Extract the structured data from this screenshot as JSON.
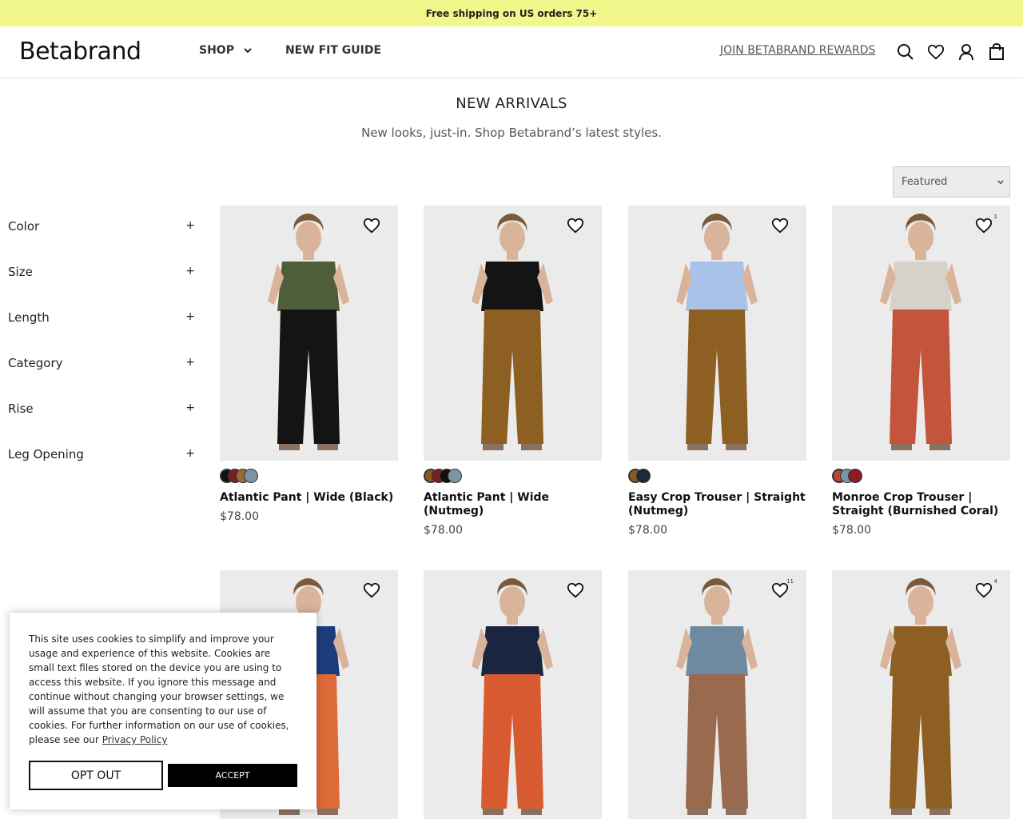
{
  "promo": {
    "text": "Free shipping on US orders 75+"
  },
  "header": {
    "logo": "Betabrand",
    "nav": {
      "shop": "SHOP",
      "fit_guide": "NEW FIT GUIDE"
    },
    "rewards": "JOIN BETABRAND REWARDS",
    "icons": [
      "search-icon",
      "heart-icon",
      "account-icon",
      "bag-icon"
    ]
  },
  "page": {
    "title": "NEW ARRIVALS",
    "subtitle": "New looks, just-in. Shop Betabrand’s latest styles.",
    "sort": "Featured"
  },
  "filters": [
    {
      "label": "Color",
      "toggle": "+"
    },
    {
      "label": "Size",
      "toggle": "+"
    },
    {
      "label": "Length",
      "toggle": "+"
    },
    {
      "label": "Category",
      "toggle": "+"
    },
    {
      "label": "Rise",
      "toggle": "+"
    },
    {
      "label": "Leg Opening",
      "toggle": "+"
    }
  ],
  "products": [
    {
      "name": "Atlantic Pant | Wide (Black)",
      "price": "$78.00",
      "wishlist_count": "",
      "swatches": [
        "#111111",
        "#7a1f24",
        "#9a6a32",
        "#7a96a6"
      ],
      "top": "#4e5e3a",
      "bottom": "#141414"
    },
    {
      "name": "Atlantic Pant | Wide (Nutmeg)",
      "price": "$78.00",
      "wishlist_count": "",
      "swatches": [
        "#8a5a25",
        "#7a1f24",
        "#111111",
        "#7a96a6"
      ],
      "top": "#141414",
      "bottom": "#8e5f22"
    },
    {
      "name": "Easy Crop Trouser | Straight (Nutmeg)",
      "price": "$78.00",
      "wishlist_count": "",
      "swatches": [
        "#8a5a25",
        "#1e2a3a"
      ],
      "top": "#a9c3e8",
      "bottom": "#8e5f22"
    },
    {
      "name": "Monroe Crop Trouser | Straight (Burnished Coral)",
      "price": "$78.00",
      "wishlist_count": "1",
      "swatches": [
        "#b84a32",
        "#7a96a6",
        "#8a1c22"
      ],
      "top": "#d7d2c8",
      "bottom": "#c4553d"
    },
    {
      "name": "",
      "price": "",
      "wishlist_count": "",
      "swatches": [],
      "top": "#1d3d7a",
      "bottom": "#de6a3a"
    },
    {
      "name": "",
      "price": "",
      "wishlist_count": "",
      "swatches": [],
      "top": "#1a2540",
      "bottom": "#d85a30"
    },
    {
      "name": "",
      "price": "",
      "wishlist_count": "11",
      "swatches": [],
      "top": "#6f8aa0",
      "bottom": "#9a6a4e"
    },
    {
      "name": "",
      "price": "",
      "wishlist_count": "4",
      "swatches": [],
      "top": "#8e5f22",
      "bottom": "#8e5f22"
    }
  ],
  "cookie": {
    "text": "This site uses cookies to simplify and improve your usage and experience of this website. Cookies are small text files stored on the device you are using to access this website. If you ignore this message and continue without changing your browser settings, we will assume that you are consenting to our use of cookies. For further information on our use of cookies, please see our",
    "link": "Privacy Policy",
    "opt_out": "OPT OUT",
    "accept": "ACCEPT"
  }
}
